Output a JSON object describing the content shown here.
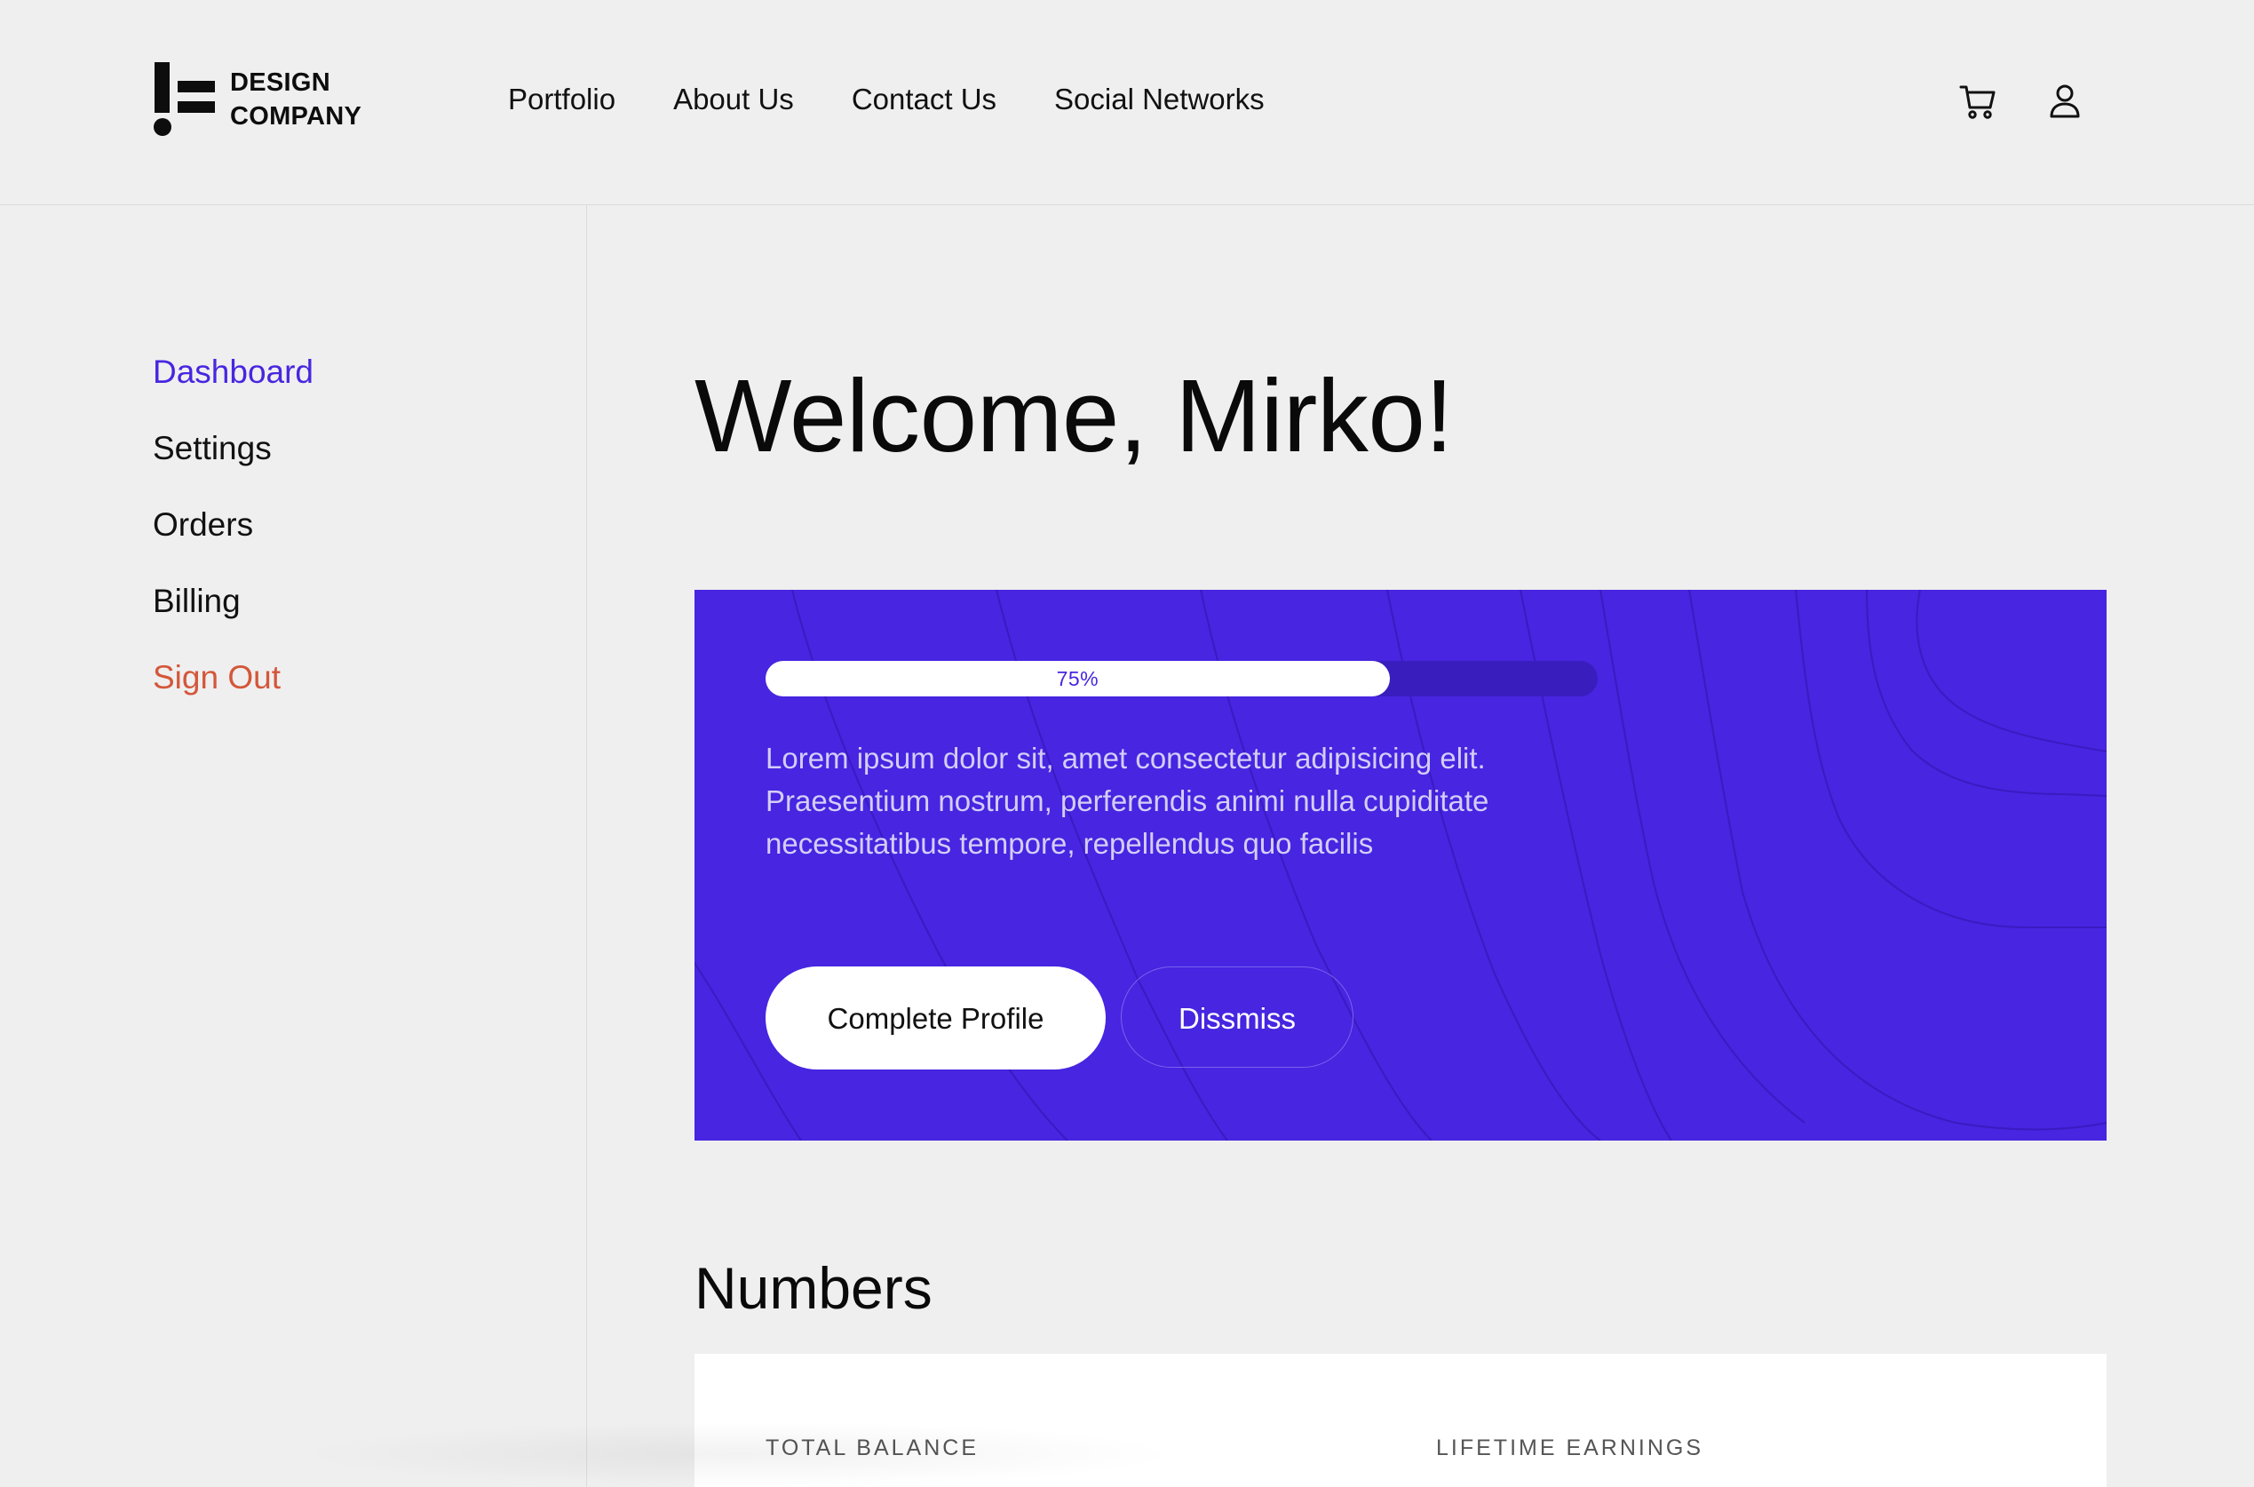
{
  "brand": {
    "name_line1": "DESIGN",
    "name_line2": "COMPANY",
    "logo_icon": "exclamation-equals-logo"
  },
  "topnav": {
    "items": [
      {
        "label": "Portfolio"
      },
      {
        "label": "About Us"
      },
      {
        "label": "Contact Us"
      },
      {
        "label": "Social Networks"
      }
    ]
  },
  "header_actions": {
    "cart_icon": "shopping-cart-icon",
    "user_icon": "user-icon"
  },
  "sidebar": {
    "items": [
      {
        "label": "Dashboard",
        "state": "active"
      },
      {
        "label": "Settings",
        "state": "normal"
      },
      {
        "label": "Orders",
        "state": "normal"
      },
      {
        "label": "Billing",
        "state": "normal"
      },
      {
        "label": "Sign Out",
        "state": "danger"
      }
    ]
  },
  "main": {
    "welcome": "Welcome, Mirko!",
    "promo": {
      "progress_percent": 75,
      "progress_label": "75%",
      "text": "Lorem ipsum dolor sit, amet consectetur adipisicing elit. Praesentium nostrum, perferendis animi nulla cupiditate necessitatibus tempore, repellendus quo facilis",
      "primary_button": "Complete Profile",
      "secondary_button": "Dissmiss"
    },
    "numbers": {
      "title": "Numbers",
      "stats": [
        {
          "label": "TOTAL BALANCE"
        },
        {
          "label": "LIFETIME EARNINGS"
        }
      ]
    }
  },
  "colors": {
    "accent": "#4725e1",
    "active_nav": "#4826e0",
    "danger": "#d4573a",
    "background": "#efefef"
  }
}
